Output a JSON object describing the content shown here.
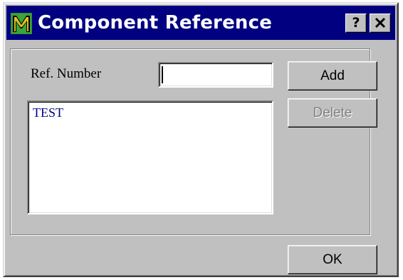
{
  "window": {
    "title": "Component Reference",
    "app_icon": "app-m-icon",
    "help_label": "?",
    "close_label": "✕"
  },
  "form": {
    "ref_label": "Ref. Number",
    "ref_value": "",
    "add_label": "Add",
    "delete_label": "Delete",
    "ok_label": "OK"
  },
  "list": {
    "items": [
      "TEST"
    ]
  },
  "colors": {
    "titlebar": "#000080",
    "face": "#c0c0c0",
    "list_text": "#000080"
  }
}
